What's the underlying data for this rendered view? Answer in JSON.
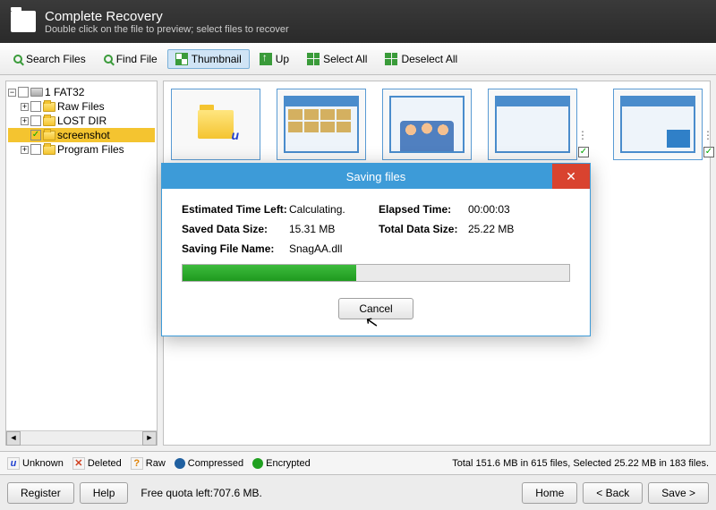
{
  "header": {
    "title": "Complete Recovery",
    "subtitle": "Double click on the file to preview; select files to recover"
  },
  "toolbar": {
    "search": "Search Files",
    "find": "Find File",
    "thumbnail": "Thumbnail",
    "up": "Up",
    "selectall": "Select All",
    "deselectall": "Deselect All"
  },
  "tree": {
    "root": "1 FAT32",
    "items": [
      {
        "label": "Raw Files",
        "checked": false
      },
      {
        "label": "LOST DIR",
        "checked": false
      },
      {
        "label": "screenshot",
        "checked": true
      },
      {
        "label": "Program Files",
        "checked": false
      }
    ]
  },
  "legend": {
    "unknown": "Unknown",
    "deleted": "Deleted",
    "raw": "Raw",
    "compressed": "Compressed",
    "encrypted": "Encrypted",
    "stats": "Total 151.6 MB in 615 files, Selected 25.22 MB in 183 files."
  },
  "bottom": {
    "register": "Register",
    "help": "Help",
    "quota": "Free quota left:707.6 MB.",
    "home": "Home",
    "back": "< Back",
    "save": "Save >"
  },
  "dialog": {
    "title": "Saving files",
    "eta_label": "Estimated Time Left:",
    "eta_value": "Calculating.",
    "elapsed_label": "Elapsed Time:",
    "elapsed_value": "00:00:03",
    "saved_label": "Saved Data Size:",
    "saved_value": "15.31 MB",
    "total_label": "Total Data Size:",
    "total_value": "25.22 MB",
    "file_label": "Saving File Name:",
    "file_value": "SnagAA.dll",
    "cancel": "Cancel"
  }
}
